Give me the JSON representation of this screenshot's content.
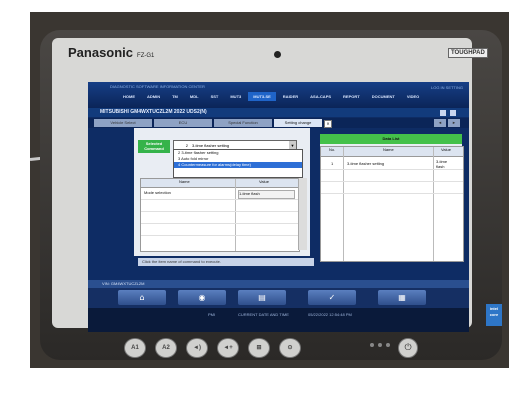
{
  "device": {
    "brand": "Panasonic",
    "model": "FZ-G1",
    "badge": "TOUGHPAD"
  },
  "app": {
    "name": "DIAGNOSTIC SOFTWARE INFORMATION CENTER",
    "window_buttons": "LOG IN   SETTING"
  },
  "nav": [
    "HOME",
    "ADMIN",
    "TM",
    "MDL",
    "SST",
    "MUT3",
    "MUT3-SE",
    "RAIDER",
    "ASA-CAPS",
    "REPORT",
    "DOCUMENT",
    "VIDEO"
  ],
  "nav_active": "MUT3-SE",
  "vehicle": {
    "info": "MITSUBISHI  GM4WXTUCZL2M 2022   UDS2(N)"
  },
  "tabs": [
    "Vehicle Select",
    "ECU",
    "Special Function",
    "Setting change"
  ],
  "active_tab": "Setting change",
  "command": {
    "label": "Selected Command",
    "selected_num": "2",
    "selected_text": "3-time flasher setting",
    "options": [
      {
        "num": "2",
        "text": "3-time flasher setting",
        "highlight": false
      },
      {
        "num": "3",
        "text": "Auto fold mirror",
        "highlight": false
      },
      {
        "num": "4",
        "text": "Countermeasure for alarms(delay time)",
        "highlight": true
      }
    ]
  },
  "left_grid": {
    "headers": [
      "Name",
      "Value"
    ],
    "rows": [
      {
        "name": "Mode selection",
        "value": "1-time flash"
      }
    ]
  },
  "hint": "Click the item name of command to execute.",
  "data_list": {
    "title": "Data List",
    "headers": [
      "No.",
      "Name",
      "Value"
    ],
    "rows": [
      {
        "no": "1",
        "name": "3-time flasher setting",
        "value": "3-time flash"
      }
    ]
  },
  "status_bar": "VIN: GM4WXTUCZL2M",
  "taskbar": {
    "label": "PMI",
    "datetime_label": "CURRENT DATE AND TIME",
    "datetime": "05/22/2022 12:54:48 PM"
  },
  "hardware_buttons": [
    "A1",
    "A2",
    "◄)",
    "◄+",
    "⊞",
    "⊙"
  ],
  "toolbar_icons": [
    "home-icon",
    "vehicle-icon",
    "print-icon",
    "check-icon",
    "table-icon"
  ],
  "colors": {
    "screen_bg": "#0e2c64",
    "accent_green": "#44c14a",
    "highlight": "#2d6fd6"
  }
}
